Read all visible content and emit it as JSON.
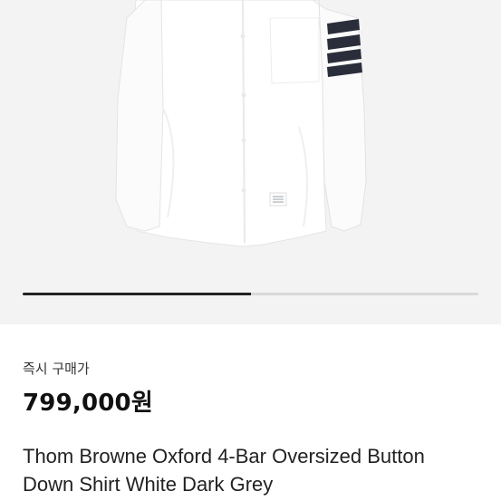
{
  "gallery": {
    "image_alt": "Thom Browne white oxford shirt with 4-bar sleeve stripes",
    "progress_fraction": 0.5
  },
  "product": {
    "price_label": "즉시 구매가",
    "price": "799,000원",
    "title": "Thom Browne Oxford 4-Bar Oversized Button Down Shirt White Dark Grey"
  },
  "colors": {
    "gallery_bg": "#f3f3f3",
    "shirt": "#ffffff",
    "stripes": "#2a2e3a",
    "progress_fill": "#222222",
    "progress_track": "#d9d9d9"
  }
}
